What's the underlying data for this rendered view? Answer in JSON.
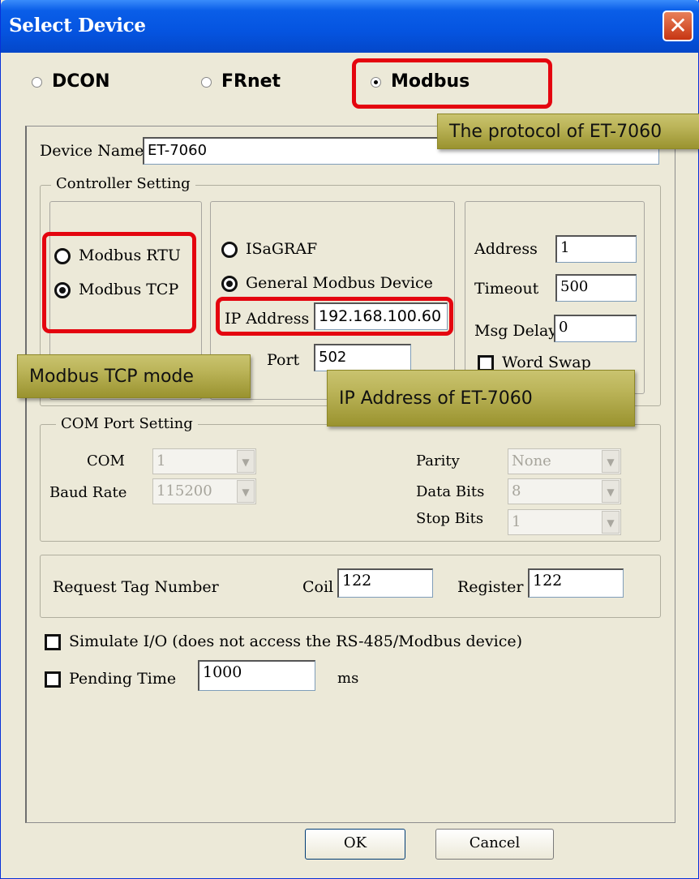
{
  "window": {
    "title": "Select Device",
    "close_label": "✕"
  },
  "protocol": {
    "options": [
      {
        "label": "DCON",
        "selected": false
      },
      {
        "label": "FRnet",
        "selected": false
      },
      {
        "label": "Modbus",
        "selected": true
      }
    ]
  },
  "device": {
    "name_label": "Device Name",
    "name_value": "ET-7060"
  },
  "controller": {
    "group_title": "Controller Setting",
    "modes": [
      {
        "label": "Modbus RTU",
        "selected": false
      },
      {
        "label": "Modbus TCP",
        "selected": true
      }
    ],
    "types": [
      {
        "label": "ISaGRAF",
        "selected": false
      },
      {
        "label": "General Modbus Device",
        "selected": true
      }
    ],
    "ip_label": "IP Address",
    "ip_value": "192.168.100.60",
    "port_label": "Port",
    "port_value": "502",
    "address_label": "Address",
    "address_value": "1",
    "timeout_label": "Timeout",
    "timeout_value": "500",
    "msgdelay_label": "Msg Delay",
    "msgdelay_value": "0",
    "wordswap_label": "Word Swap"
  },
  "com": {
    "group_title": "COM Port Setting",
    "com_label": "COM",
    "com_value": "1",
    "baud_label": "Baud Rate",
    "baud_value": "115200",
    "parity_label": "Parity",
    "parity_value": "None",
    "databits_label": "Data Bits",
    "databits_value": "8",
    "stopbits_label": "Stop Bits",
    "stopbits_value": "1"
  },
  "tags": {
    "request_label": "Request Tag Number",
    "coil_label": "Coil",
    "coil_value": "122",
    "register_label": "Register",
    "register_value": "122"
  },
  "options": {
    "simulate_label": "Simulate I/O (does not access the RS-485/Modbus device)",
    "pending_label": "Pending Time",
    "pending_value": "1000",
    "pending_unit": "ms"
  },
  "buttons": {
    "ok": "OK",
    "cancel": "Cancel"
  },
  "callouts": {
    "protocol": "The protocol of ET-7060",
    "tcp_mode": "Modbus TCP mode",
    "ip": "IP Address of ET-7060"
  },
  "colors": {
    "highlight": "#e4050f",
    "callout": "#bcb55a",
    "titlebar": "#0554e0"
  }
}
